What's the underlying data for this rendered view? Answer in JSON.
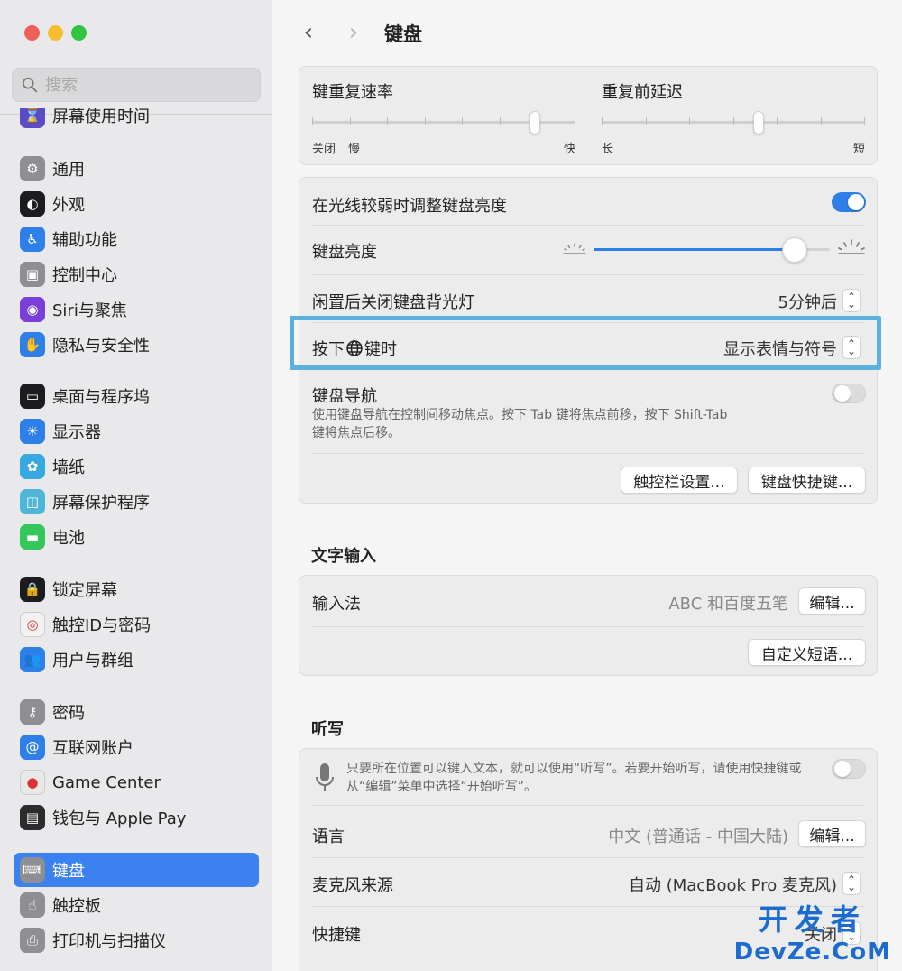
{
  "search": {
    "placeholder": "搜索"
  },
  "sidebar": {
    "items": [
      {
        "label": "屏幕使用时间",
        "color": "#5b4bc7",
        "icon": "hourglass-icon"
      },
      {
        "label": "通用",
        "color": "#8e8e93",
        "icon": "gear-icon"
      },
      {
        "label": "外观",
        "color": "#1c1c1e",
        "icon": "appearance-icon"
      },
      {
        "label": "辅助功能",
        "color": "#2f7fe8",
        "icon": "accessibility-icon"
      },
      {
        "label": "控制中心",
        "color": "#8e8e93",
        "icon": "control-center-icon"
      },
      {
        "label": "Siri与聚焦",
        "color": "#7a3fd8",
        "icon": "siri-icon"
      },
      {
        "label": "隐私与安全性",
        "color": "#2f7fe8",
        "icon": "hand-icon"
      },
      {
        "label": "桌面与程序坞",
        "color": "#1c1c1e",
        "icon": "dock-icon"
      },
      {
        "label": "显示器",
        "color": "#2f7fe8",
        "icon": "sun-icon"
      },
      {
        "label": "墙纸",
        "color": "#38a8e0",
        "icon": "flower-icon"
      },
      {
        "label": "屏幕保护程序",
        "color": "#4fb6d9",
        "icon": "screensaver-icon"
      },
      {
        "label": "电池",
        "color": "#34c759",
        "icon": "battery-icon"
      },
      {
        "label": "锁定屏幕",
        "color": "#1c1c1e",
        "icon": "lock-icon"
      },
      {
        "label": "触控ID与密码",
        "color": "#f2f2f2",
        "icon": "fingerprint-icon"
      },
      {
        "label": "用户与群组",
        "color": "#2f7fe8",
        "icon": "users-icon"
      },
      {
        "label": "密码",
        "color": "#8e8e93",
        "icon": "key-icon"
      },
      {
        "label": "互联网账户",
        "color": "#2f7fe8",
        "icon": "at-icon"
      },
      {
        "label": "Game Center",
        "color": "#e8e8e8",
        "icon": "game-center-icon"
      },
      {
        "label": "钱包与 Apple Pay",
        "color": "#2c2c2e",
        "icon": "wallet-icon"
      },
      {
        "label": "键盘",
        "color": "#8e8e93",
        "icon": "keyboard-icon"
      },
      {
        "label": "触控板",
        "color": "#8e8e93",
        "icon": "trackpad-icon"
      },
      {
        "label": "打印机与扫描仪",
        "color": "#8e8e93",
        "icon": "printer-icon"
      }
    ],
    "active_index": 19
  },
  "header": {
    "back": "‹",
    "forward": "›",
    "title": "键盘"
  },
  "repeat": {
    "rate_label": "键重复速率",
    "rate_off": "关闭",
    "rate_slow": "慢",
    "rate_fast": "快",
    "delay_label": "重复前延迟",
    "delay_long": "长",
    "delay_short": "短"
  },
  "backlight": {
    "auto_label": "在光线较弱时调整键盘亮度",
    "auto_on": true,
    "brightness_label": "键盘亮度",
    "brightness_level": 0.85,
    "idle_label": "闲置后关闭键盘背光灯",
    "idle_value": "5分钟后",
    "globe_label_pre": "按下",
    "globe_label_post": "键时",
    "globe_value": "显示表情与符号",
    "nav_label": "键盘导航",
    "nav_desc_1": "使用键盘导航在控制间移动焦点。按下 Tab 键将焦点前移，按下 Shift-Tab",
    "nav_desc_2": "键将焦点后移。",
    "nav_on": false,
    "touchbar_btn": "触控栏设置...",
    "shortcuts_btn": "键盘快捷键..."
  },
  "text_input": {
    "section": "文字输入",
    "ime_label": "输入法",
    "ime_value": "ABC 和百度五笔",
    "edit_btn": "编辑...",
    "custom_btn": "自定义短语..."
  },
  "dictation": {
    "section": "听写",
    "desc_1": "只要所在位置可以键入文本，就可以使用“听写”。若要开始听写，请使用快捷键或",
    "desc_2": "从“编辑”菜单中选择“开始听写”。",
    "enabled": false,
    "lang_label": "语言",
    "lang_value": "中文 (普通话 - 中国大陆)",
    "edit_btn": "编辑...",
    "mic_label": "麦克风来源",
    "mic_value": "自动 (MacBook Pro 麦克风)",
    "shortcut_label": "快捷键",
    "shortcut_value": "关闭"
  },
  "watermark": {
    "top": "开发者",
    "bottom": "DevZe.CoM"
  }
}
